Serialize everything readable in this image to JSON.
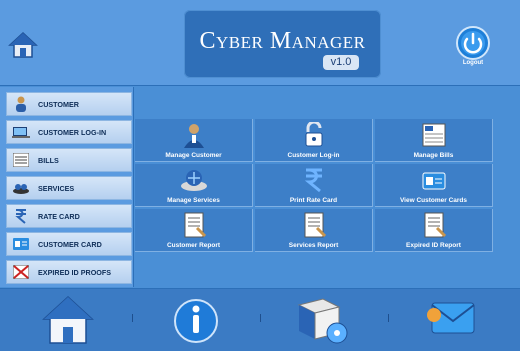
{
  "header": {
    "title": "Cyber Manager",
    "version": "v1.0",
    "logout_label": "Logout"
  },
  "sidebar": {
    "items": [
      {
        "label": "CUSTOMER",
        "icon": "customer-icon"
      },
      {
        "label": "CUSTOMER LOG-IN",
        "icon": "customer-login-icon"
      },
      {
        "label": "BILLS",
        "icon": "bills-icon"
      },
      {
        "label": "SERVICES",
        "icon": "services-icon"
      },
      {
        "label": "RATE CARD",
        "icon": "rate-card-icon"
      },
      {
        "label": "CUSTOMER CARD",
        "icon": "customer-card-icon"
      },
      {
        "label": "EXPIRED ID PROOFS",
        "icon": "expired-id-icon"
      }
    ]
  },
  "grid": {
    "tiles": [
      {
        "label": "Manage Customer",
        "icon": "manage-customer-icon"
      },
      {
        "label": "Customer Log-in",
        "icon": "customer-login-icon"
      },
      {
        "label": "Manage Bills",
        "icon": "manage-bills-icon"
      },
      {
        "label": "Manage Services",
        "icon": "manage-services-icon"
      },
      {
        "label": "Print Rate Card",
        "icon": "rupee-icon"
      },
      {
        "label": "View Customer Cards",
        "icon": "customer-cards-icon"
      },
      {
        "label": "Customer Report",
        "icon": "report-icon"
      },
      {
        "label": "Services Report",
        "icon": "report-icon"
      },
      {
        "label": "Expired ID Report",
        "icon": "report-icon"
      }
    ]
  },
  "footer": {
    "buttons": [
      {
        "icon": "home-icon"
      },
      {
        "icon": "info-icon"
      },
      {
        "icon": "software-box-icon"
      },
      {
        "icon": "mail-icon"
      }
    ]
  },
  "colors": {
    "background": "#4a8fd6",
    "title_box": "#2f6fb8",
    "sidebar_item": "#c8ddf4",
    "tile": "#3d7fc8"
  }
}
